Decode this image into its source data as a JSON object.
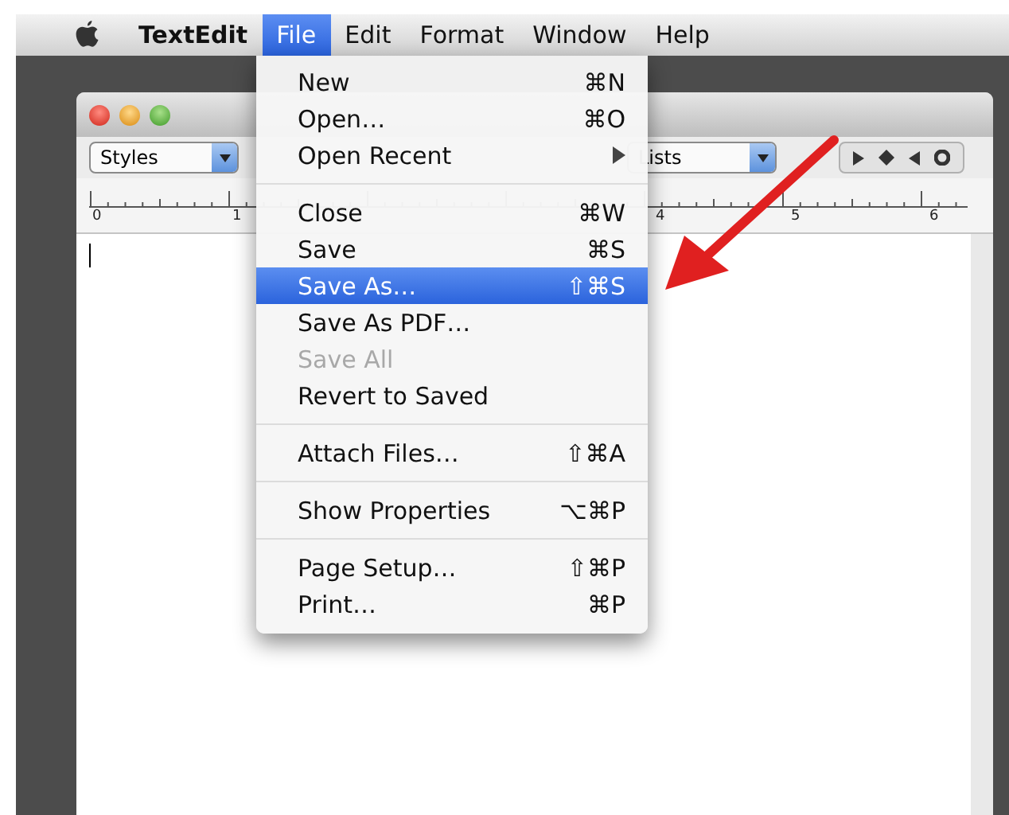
{
  "menu_bar": [
    {
      "label": "TextEdit",
      "kind": "app",
      "selected": false
    },
    {
      "label": "File",
      "kind": "menu",
      "selected": true
    },
    {
      "label": "Edit",
      "kind": "menu",
      "selected": false
    },
    {
      "label": "Format",
      "kind": "menu",
      "selected": false
    },
    {
      "label": "Window",
      "kind": "menu",
      "selected": false
    },
    {
      "label": "Help",
      "kind": "menu",
      "selected": false
    }
  ],
  "toolbar": {
    "styles": "Styles",
    "lists": "Lists"
  },
  "ruler": {
    "labels": [
      "0",
      "1",
      "4",
      "5",
      "6"
    ]
  },
  "file_menu": {
    "sections": [
      [
        {
          "label": "New",
          "shortcut": "⌘N",
          "selected": false,
          "disabled": false,
          "submenu": false
        },
        {
          "label": "Open…",
          "shortcut": "⌘O",
          "selected": false,
          "disabled": false,
          "submenu": false
        },
        {
          "label": "Open Recent",
          "selected": false,
          "disabled": false,
          "submenu": true
        }
      ],
      [
        {
          "label": "Close",
          "shortcut": "⌘W",
          "selected": false,
          "disabled": false,
          "submenu": false
        },
        {
          "label": "Save",
          "shortcut": "⌘S",
          "selected": false,
          "disabled": false,
          "submenu": false
        },
        {
          "label": "Save As…",
          "shortcut": "⇧⌘S",
          "selected": true,
          "disabled": false,
          "submenu": false
        },
        {
          "label": "Save As PDF…",
          "selected": false,
          "disabled": false,
          "submenu": false
        },
        {
          "label": "Save All",
          "selected": false,
          "disabled": true,
          "submenu": false
        },
        {
          "label": "Revert to Saved",
          "selected": false,
          "disabled": false,
          "submenu": false
        }
      ],
      [
        {
          "label": "Attach Files…",
          "shortcut": "⇧⌘A",
          "selected": false,
          "disabled": false,
          "submenu": false
        }
      ],
      [
        {
          "label": "Show Properties",
          "shortcut": "⌥⌘P",
          "selected": false,
          "disabled": false,
          "submenu": false
        }
      ],
      [
        {
          "label": "Page Setup…",
          "shortcut": "⇧⌘P",
          "selected": false,
          "disabled": false,
          "submenu": false
        },
        {
          "label": "Print…",
          "shortcut": "⌘P",
          "selected": false,
          "disabled": false,
          "submenu": false
        }
      ]
    ]
  }
}
